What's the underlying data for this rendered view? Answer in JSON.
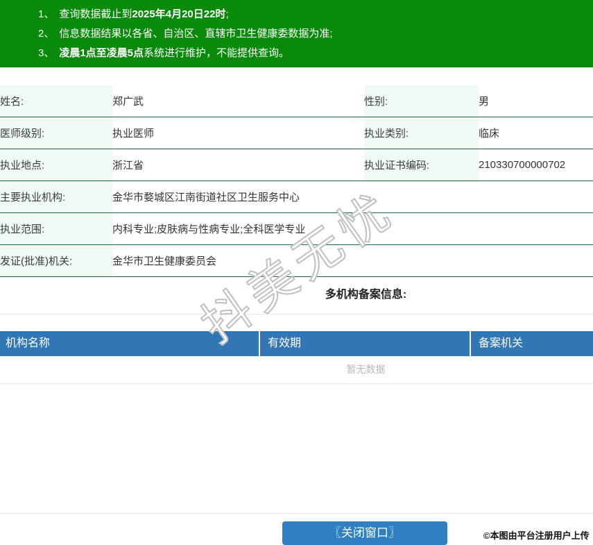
{
  "banner": {
    "notices": [
      {
        "num": "1、",
        "pre": "查询数据截止到",
        "bold": "2025年4月20日22时",
        "post": ";"
      },
      {
        "num": "2、",
        "pre": "信息数据结果以各省、自治区、直辖市卫生健康委数据为准;",
        "bold": "",
        "post": ""
      },
      {
        "num": "3、",
        "pre": "",
        "bold": "凌晨1点至凌晨5点",
        "post": "系统进行维护，不能提供查询。"
      }
    ]
  },
  "info": {
    "rows4": [
      {
        "l1": "姓名:",
        "v1": "郑广武",
        "l2": "性别:",
        "v2": "男"
      },
      {
        "l1": "医师级别:",
        "v1": "执业医师",
        "l2": "执业类别:",
        "v2": "临床"
      },
      {
        "l1": "执业地点:",
        "v1": "浙江省",
        "l2": "执业证书编码:",
        "v2": "210330700000702"
      }
    ],
    "rows2": [
      {
        "l": "主要执业机构:",
        "v": "金华市婺城区江南街道社区卫生服务中心"
      },
      {
        "l": "执业范围:",
        "v": "内科专业;皮肤病与性病专业;全科医学专业"
      },
      {
        "l": "发证(批准)机关:",
        "v": "金华市卫生健康委员会"
      }
    ]
  },
  "registry": {
    "title": "多机构备案信息:",
    "columns": [
      "机构名称",
      "有效期",
      "备案机关"
    ],
    "empty_text": "暂无数据"
  },
  "footer": {
    "close_button": "〖关闭窗口〗"
  },
  "overlays": {
    "watermark": "抖美无忧",
    "copyright": "©本图由平台注册用户上传"
  },
  "colors": {
    "banner_green": "#0a8a0a",
    "table_header_blue": "#3277b5",
    "button_blue": "#3080c1",
    "row_divider_green": "#166b3f",
    "label_bg_mint": "#eefaf3"
  }
}
